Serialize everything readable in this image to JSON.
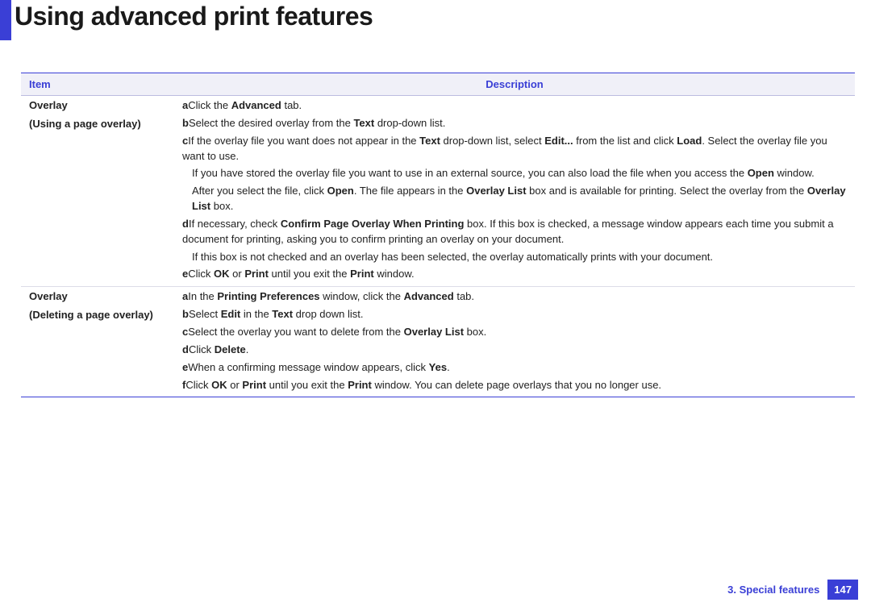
{
  "title": "Using advanced print features",
  "headers": {
    "item": "Item",
    "description": "Description"
  },
  "rows": [
    {
      "item_title": "Overlay",
      "item_sub": "(Using a page overlay)",
      "a_letter": "a",
      "a_pre": "Click the ",
      "a_b1": "Advanced",
      "a_post": " tab.",
      "b_letter": "b",
      "b_pre": "Select the desired overlay from the ",
      "b_b1": "Text",
      "b_post": " drop-down list.",
      "c_letter": "c",
      "c_pre": "If the overlay file you want does not appear in the ",
      "c_b1": "Text",
      "c_mid1": " drop-down list, select ",
      "c_b2": "Edit...",
      "c_mid2": " from the list and click ",
      "c_b3": "Load",
      "c_post": ". Select the overlay file you want to use.",
      "c2_pre": "If you have stored the overlay file you want to use in an external source, you can also load the file when you access the ",
      "c2_b1": "Open",
      "c2_post": " window.",
      "c3_pre": "After you select the file, click ",
      "c3_b1": "Open",
      "c3_mid1": ". The file appears in the ",
      "c3_b2": "Overlay List",
      "c3_mid2": " box and is available for printing. Select the overlay from the ",
      "c3_b3": "Overlay List",
      "c3_post": " box.",
      "d_letter": "d",
      "d_pre": "If necessary, check ",
      "d_b1": "Confirm Page Overlay When Printing",
      "d_post": " box. If this box is checked, a message window appears each time you submit a document for printing, asking you to confirm printing an overlay on your document.",
      "d2": "If this box is not checked and an overlay has been selected, the overlay automatically prints with your document.",
      "e_letter": "e",
      "e_pre": "Click ",
      "e_b1": "OK",
      "e_mid1": " or ",
      "e_b2": "Print",
      "e_mid2": " until you exit the ",
      "e_b3": "Print",
      "e_post": " window."
    },
    {
      "item_title": "Overlay",
      "item_sub": "(Deleting a page overlay)",
      "a_letter": "a",
      "a_pre": "In the ",
      "a_b1": "Printing Preferences",
      "a_mid1": " window, click the ",
      "a_b2": "Advanced",
      "a_post": " tab.",
      "b_letter": "b",
      "b_pre": "Select ",
      "b_b1": "Edit",
      "b_mid1": " in the ",
      "b_b2": "Text",
      "b_post": " drop down list.",
      "c_letter": "c",
      "c_pre": "Select the overlay you want to delete from the ",
      "c_b1": "Overlay List",
      "c_post": " box.",
      "d_letter": "d",
      "d_pre": "Click ",
      "d_b1": "Delete",
      "d_post": ".",
      "e_letter": "e",
      "e_pre": "When a confirming message window appears, click ",
      "e_b1": "Yes",
      "e_post": ".",
      "f_letter": "f",
      "f_pre": "Click ",
      "f_b1": "OK",
      "f_mid1": " or ",
      "f_b2": "Print",
      "f_mid2": " until you exit the ",
      "f_b3": "Print",
      "f_post": " window. You can delete page overlays that you no longer use."
    }
  ],
  "footer": {
    "chapter": "3.  Special features",
    "page": "147"
  }
}
